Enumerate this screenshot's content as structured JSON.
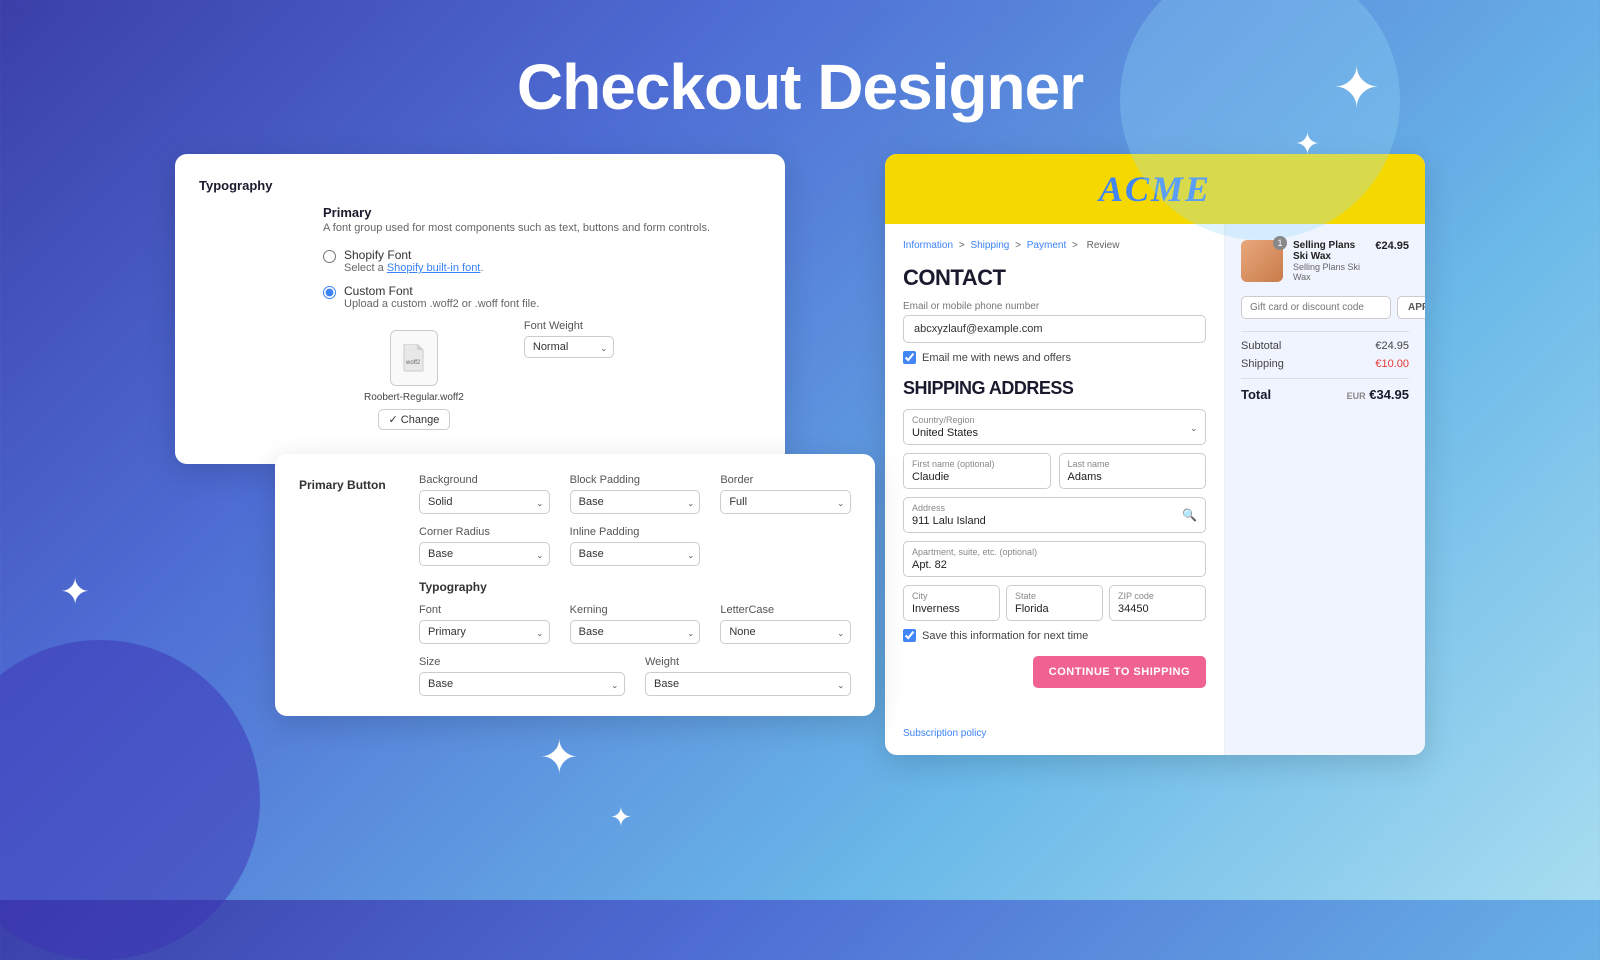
{
  "page": {
    "title": "Checkout Designer"
  },
  "sparkles": {
    "chars": "✦"
  },
  "typography_panel": {
    "section_label": "Typography",
    "primary_label": "Primary",
    "primary_desc": "A font group used for most components such as text, buttons and form controls.",
    "shopify_font_label": "Shopify Font",
    "shopify_font_sub_prefix": "Select a ",
    "shopify_font_link": "Shopify built-in font",
    "shopify_font_sub_suffix": ".",
    "custom_font_label": "Custom Font",
    "custom_font_sub": "Upload a custom .woff2 or .woff font file.",
    "font_file_name": "Roobert-Regular.woff2",
    "change_btn": "✓ Change",
    "font_weight_label": "Font Weight",
    "font_weight_value": "Normal"
  },
  "primary_button_panel": {
    "title": "Primary Button",
    "bg_label": "Background",
    "bg_value": "Solid",
    "block_padding_label": "Block Padding",
    "block_padding_value": "Base",
    "border_label": "Border",
    "border_value": "Full",
    "corner_radius_label": "Corner Radius",
    "corner_radius_value": "Base",
    "inline_padding_label": "Inline Padding",
    "inline_padding_value": "Base",
    "typography_section": "Typography",
    "font_label": "Font",
    "font_value": "Primary",
    "kerning_label": "Kerning",
    "kerning_value": "Base",
    "lettercase_label": "LetterCase",
    "lettercase_value": "None",
    "size_label": "Size",
    "size_value": "Base",
    "weight_label": "Weight",
    "weight_value": "Base"
  },
  "checkout_preview": {
    "logo": "ACME",
    "breadcrumb": [
      "Information",
      "Shipping",
      "Payment",
      "Review"
    ],
    "contact": {
      "heading": "CONTACT",
      "field_label": "Email or mobile phone number",
      "field_placeholder": "abcxyzlauf@example.com",
      "checkbox_label": "Email me with news and offers"
    },
    "shipping": {
      "heading": "SHIPPING ADDRESS",
      "country_label": "Country/Region",
      "country_value": "United States",
      "first_name_label": "First name (optional)",
      "first_name_value": "Claudie",
      "last_name_label": "Last name",
      "last_name_value": "Adams",
      "address_label": "Address",
      "address_value": "911 Lalu Island",
      "apt_label": "Apartment, suite, etc. (optional)",
      "apt_value": "Apt. 82",
      "city_label": "City",
      "city_value": "Inverness",
      "state_label": "State",
      "state_value": "Florida",
      "zip_label": "ZIP code",
      "zip_value": "34450",
      "save_label": "Save this information for next time",
      "continue_btn": "CONTINUE TO SHIPPING"
    },
    "order_summary": {
      "product_name": "Selling Plans Ski Wax",
      "product_sub": "Selling Plans Ski Wax",
      "product_price": "€24.95",
      "product_qty": "1",
      "discount_placeholder": "Gift card or discount code",
      "apply_btn": "APPLY",
      "subtotal_label": "Subtotal",
      "subtotal_value": "€24.95",
      "shipping_label": "Shipping",
      "shipping_value": "€10.00",
      "total_label": "Total",
      "total_est": "EUR",
      "total_value": "€34.95"
    },
    "subscription_link": "Subscription policy"
  }
}
